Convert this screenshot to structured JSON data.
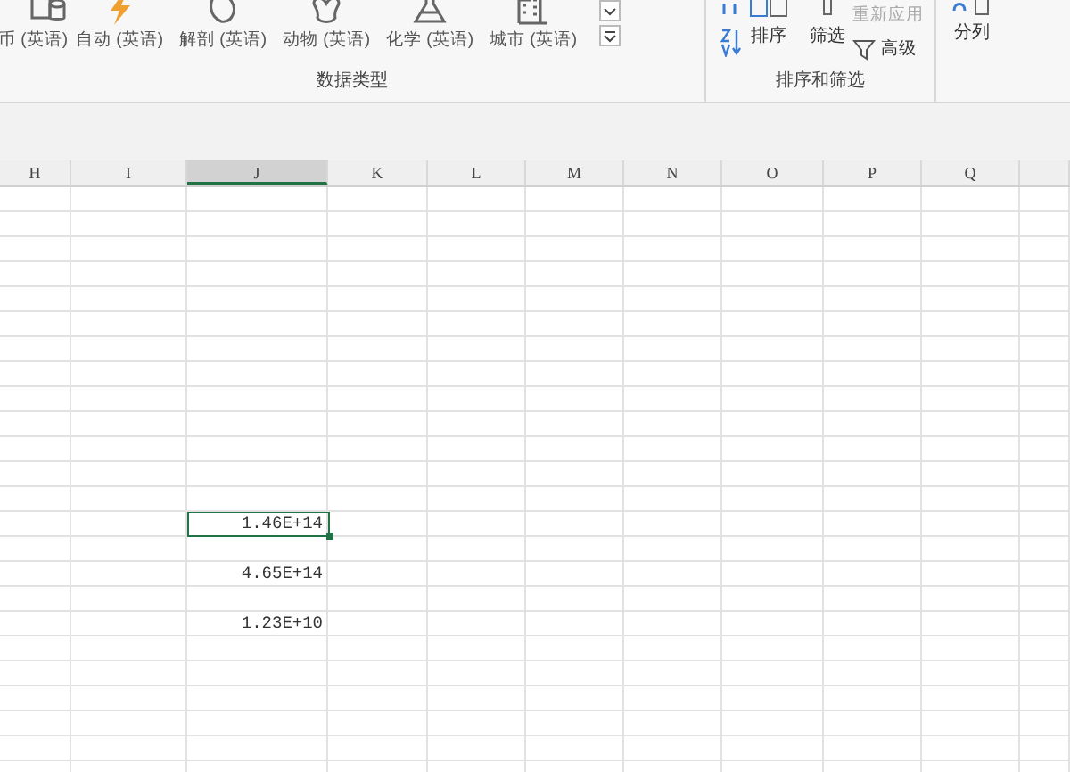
{
  "ribbon": {
    "data_types": {
      "items": [
        {
          "label": "币 (英语)"
        },
        {
          "label": "自动 (英语)"
        },
        {
          "label": "解剖 (英语)"
        },
        {
          "label": "动物 (英语)"
        },
        {
          "label": "化学 (英语)"
        },
        {
          "label": "城市 (英语)"
        }
      ],
      "group_label": "数据类型"
    },
    "sort_filter": {
      "sort_label": "排序",
      "filter_label": "筛选",
      "reapply": {
        "label": "重新应用",
        "disabled": true
      },
      "advanced": {
        "label": "高级",
        "disabled": false
      },
      "group_label": "排序和筛选"
    },
    "text_to_columns": {
      "label": "分列"
    }
  },
  "sheet": {
    "columns": [
      {
        "label": "H",
        "selected": false
      },
      {
        "label": "I",
        "selected": false
      },
      {
        "label": "J",
        "selected": true
      },
      {
        "label": "K",
        "selected": false
      },
      {
        "label": "L",
        "selected": false
      },
      {
        "label": "M",
        "selected": false
      },
      {
        "label": "N",
        "selected": false
      },
      {
        "label": "O",
        "selected": false
      },
      {
        "label": "P",
        "selected": false
      },
      {
        "label": "Q",
        "selected": false
      }
    ],
    "cells": [
      {
        "value": "1.46E+14",
        "selected": true
      },
      {
        "value": "4.65E+14",
        "selected": false
      },
      {
        "value": "1.23E+10",
        "selected": false
      }
    ]
  }
}
